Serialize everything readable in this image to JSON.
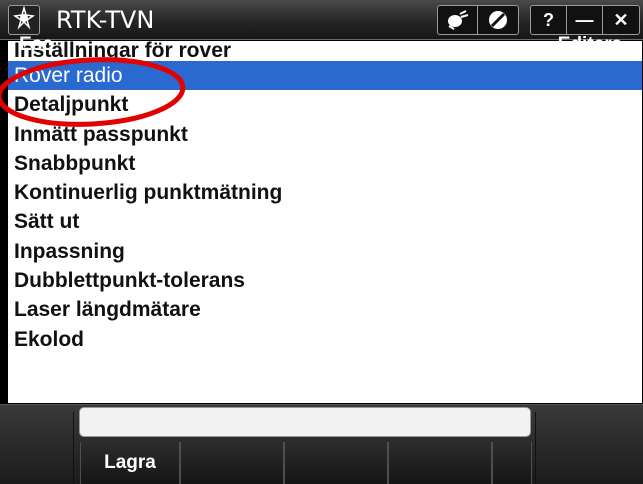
{
  "window": {
    "title": "RTK-TVN",
    "logo_icon": "trimble-rose-icon",
    "toolbar_icons": [
      "satellite-status-icon",
      "no-signal-icon"
    ],
    "help_label": "?",
    "minimize_label": "—",
    "close_label": "✕"
  },
  "list": {
    "items": [
      "Inställningar för rover",
      "Rover radio",
      "Detaljpunkt",
      "Inmätt passpunkt",
      "Snabbpunkt",
      "Kontinuerlig punktmätning",
      "Sätt ut",
      "Inpassning",
      "Dubblettpunkt-tolerans",
      "Laser längdmätare",
      "Ekolod"
    ],
    "selected_index": 1,
    "selected_color": "#2a6ad0"
  },
  "annotation": {
    "color": "#e30000"
  },
  "softkeys": {
    "esc": "Esc",
    "edit": "Editera",
    "save": "Lagra",
    "input_value": ""
  }
}
